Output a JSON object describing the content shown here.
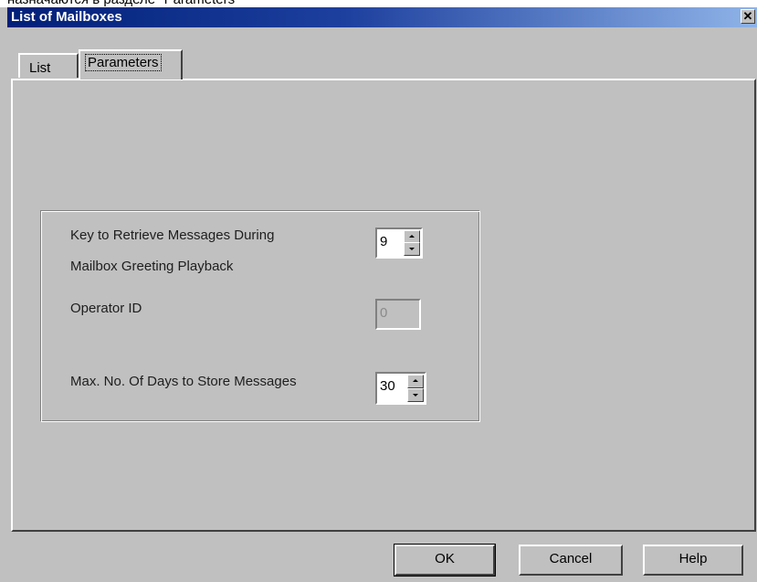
{
  "page_caption": "назначаются в разделе \"Parameters\"",
  "window": {
    "title": "List of Mailboxes",
    "close_glyph": "✕"
  },
  "tabs": [
    {
      "label": "List",
      "active": false
    },
    {
      "label": "Parameters",
      "active": true
    }
  ],
  "parameters": {
    "retrieve_key": {
      "label_line1": "Key to Retrieve Messages During",
      "label_line2": "Mailbox Greeting Playback",
      "value": "9"
    },
    "operator_id": {
      "label": "Operator ID",
      "value": "0",
      "disabled": true
    },
    "max_days": {
      "label": "Max. No. Of Days to Store Messages",
      "value": "30"
    }
  },
  "buttons": {
    "ok": "OK",
    "cancel": "Cancel",
    "help": "Help"
  },
  "colors": {
    "dialog_face": "#c0c0c0",
    "title_start": "#002078",
    "title_end": "#8fb4e8"
  }
}
